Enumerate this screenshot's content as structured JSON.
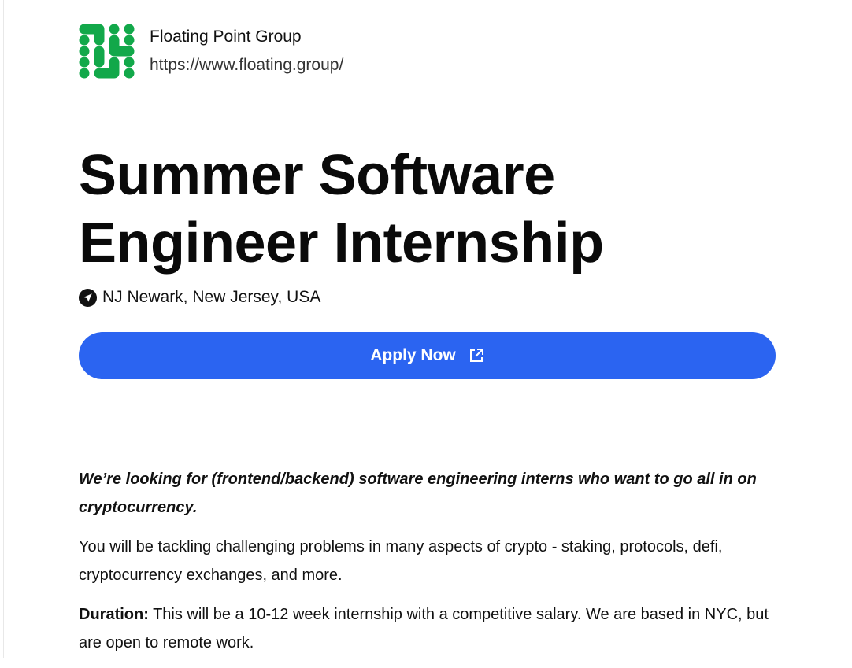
{
  "company": {
    "name": "Floating Point Group",
    "url": "https://www.floating.group/",
    "brand_color": "#12a84a"
  },
  "job": {
    "title": "Summer Software Engineer Internship",
    "location": "NJ Newark, New Jersey, USA"
  },
  "apply_button": {
    "label": "Apply Now",
    "color": "#2b64f1",
    "icon": "external-link-icon"
  },
  "description": {
    "lead": "We’re looking for (frontend/backend) software engineering interns who want to go all in on cryptocurrency.",
    "paragraph": "You will be tackling challenging problems in many aspects of crypto - staking, protocols, defi, cryptocurrency exchanges, and more.",
    "duration_label": "Duration:",
    "duration_text": " This will be a 10-12 week internship with a competitive salary. We are based in NYC, but are open to remote work."
  }
}
